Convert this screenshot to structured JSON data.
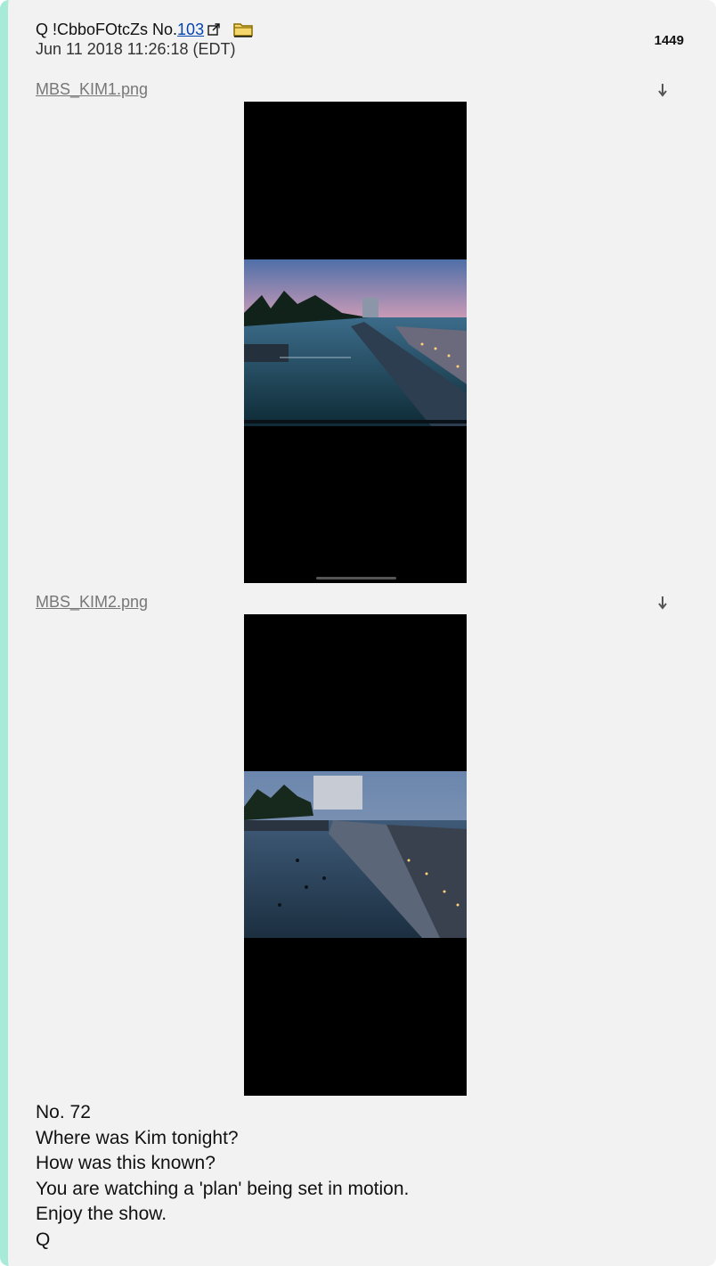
{
  "post": {
    "author": "Q !CbboFOtcZs No.",
    "number_link": "103",
    "timestamp": "Jun 11 2018 11:26:18 (EDT)",
    "count": "1449",
    "accent_color": "#a8ead8",
    "link_color": "#0645ad"
  },
  "attachments": [
    {
      "filename": "MBS_KIM1.png",
      "icon": "download-arrow-icon"
    },
    {
      "filename": "MBS_KIM2.png",
      "icon": "download-arrow-icon"
    }
  ],
  "message": {
    "lines": [
      "No. 72",
      "Where was Kim tonight?",
      "How was this known?",
      "You are watching a 'plan' being set in motion.",
      "Enjoy the show.",
      "Q"
    ]
  }
}
